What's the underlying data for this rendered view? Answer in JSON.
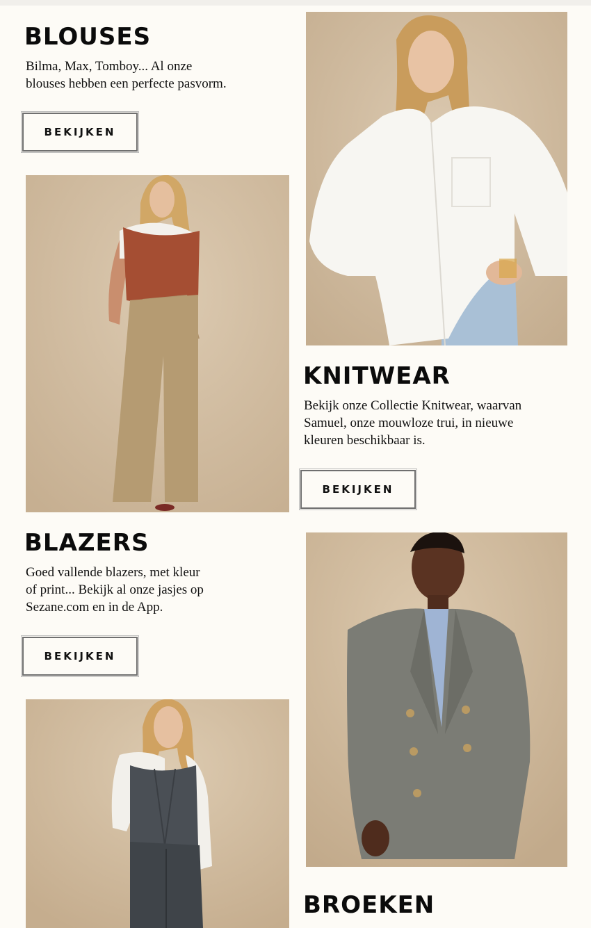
{
  "sections": [
    {
      "title": "BLOUSES",
      "description_lines": [
        "Bilma, Max, Tomboy... Al onze",
        "blouses hebben een perfecte pasvorm."
      ],
      "button_label": "BEKIJKEN"
    },
    {
      "title": "KNITWEAR",
      "description_lines": [
        "Bekijk onze Collectie Knitwear, waarvan",
        "Samuel, onze mouwloze trui, in nieuwe",
        "kleuren beschikbaar is."
      ],
      "button_label": "BEKIJKEN"
    },
    {
      "title": "BLAZERS",
      "description_lines": [
        "Goed vallende blazers, met kleur",
        "of print... Bekijk al onze jasjes op",
        "Sezane.com en in de App."
      ],
      "button_label": "BEKIJKEN"
    },
    {
      "title": "BROEKEN"
    }
  ],
  "colors": {
    "background": "#fdfbf6",
    "photo_backdrop": "#cdb89c",
    "text": "#111111",
    "button_border": "#6f6f6f"
  },
  "icons": {
    "photo_white_shirt": "model-white-shirt-photo",
    "photo_knit_vest": "model-rust-knit-vest-photo",
    "photo_grey_blazer": "model-grey-blazer-photo",
    "photo_grey_waistcoat": "model-grey-waistcoat-photo"
  }
}
